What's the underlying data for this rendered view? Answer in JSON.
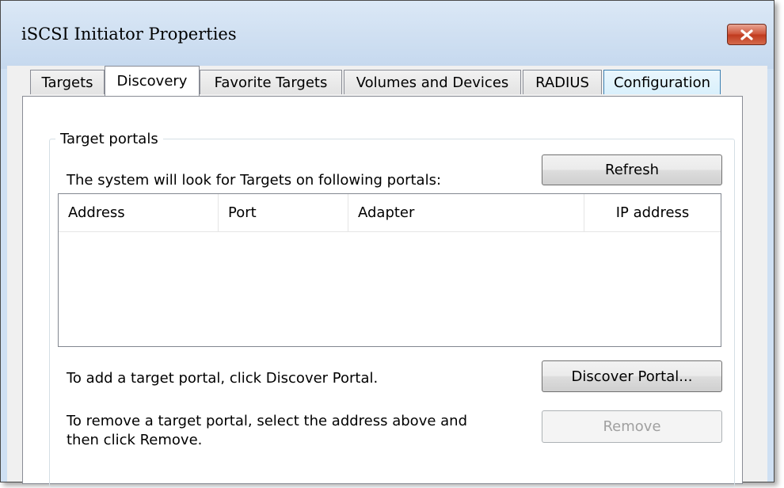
{
  "window": {
    "title": "iSCSI Initiator Properties"
  },
  "tabs": [
    {
      "label": "Targets"
    },
    {
      "label": "Discovery"
    },
    {
      "label": "Favorite Targets"
    },
    {
      "label": "Volumes and Devices"
    },
    {
      "label": "RADIUS"
    },
    {
      "label": "Configuration"
    }
  ],
  "active_tab": "Discovery",
  "target_portals": {
    "group_label": "Target portals",
    "description": "The system will look for Targets on following portals:",
    "refresh_label": "Refresh",
    "columns": [
      "Address",
      "Port",
      "Adapter",
      "IP address"
    ],
    "rows": [],
    "add_instruction": "To add a target portal, click Discover Portal.",
    "discover_label": "Discover Portal...",
    "remove_instruction_line1": "To remove a target portal, select the address above and",
    "remove_instruction_line2": "then click Remove.",
    "remove_label": "Remove",
    "remove_enabled": false
  },
  "icons": {
    "close": "close-icon"
  },
  "colors": {
    "close_button": "#c9472b",
    "hover_tab_border": "#3c7fb1"
  }
}
